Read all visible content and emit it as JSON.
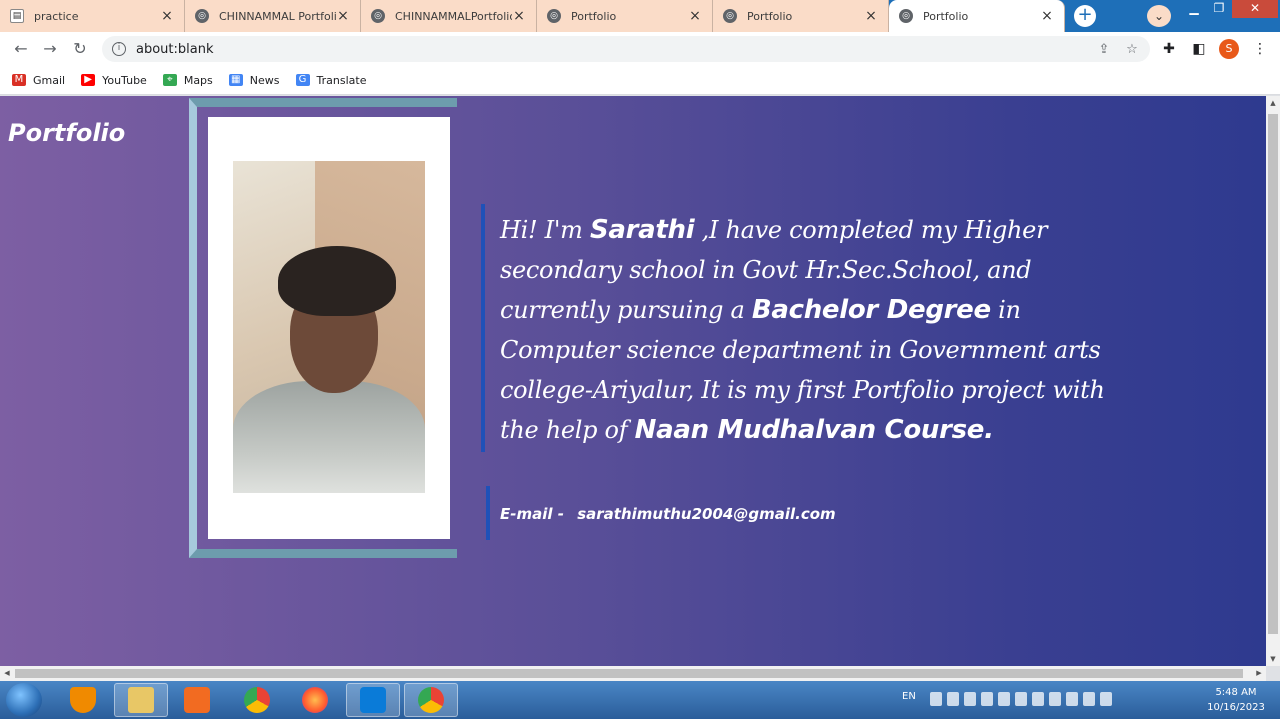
{
  "tabs": [
    {
      "title": "practice",
      "icon": "document-icon",
      "active": false
    },
    {
      "title": "CHINNAMMAL Portfolio",
      "icon": "globe-icon",
      "active": false
    },
    {
      "title": "CHINNAMMALPortfolio",
      "icon": "globe-icon",
      "active": false
    },
    {
      "title": "Portfolio",
      "icon": "globe-icon",
      "active": false
    },
    {
      "title": "Portfolio",
      "icon": "globe-icon",
      "active": false
    },
    {
      "title": "Portfolio",
      "icon": "globe-icon",
      "active": true
    }
  ],
  "address_bar": {
    "url": "about:blank"
  },
  "profile_initial": "S",
  "bookmarks": [
    {
      "label": "Gmail",
      "icon": "gmail-icon",
      "color": "#d93025"
    },
    {
      "label": "YouTube",
      "icon": "youtube-icon",
      "color": "#ff0000"
    },
    {
      "label": "Maps",
      "icon": "maps-icon",
      "color": "#34a853"
    },
    {
      "label": "News",
      "icon": "news-icon",
      "color": "#4285f4"
    },
    {
      "label": "Translate",
      "icon": "translate-icon",
      "color": "#4285f4"
    }
  ],
  "page": {
    "logo": "Portfolio",
    "intro": {
      "t1": "Hi! I'm ",
      "name": "Sarathi",
      "t2": " ,I have completed my Higher secondary school in Govt Hr.Sec.School, and currently pursuing a ",
      "degree": "Bachelor Degree",
      "t3": " in Computer science department in Government arts college-Ariyalur, It is my first Portfolio project with the help of ",
      "course": "Naan Mudhalvan Course."
    },
    "email": {
      "label": "E-mail -",
      "value": "sarathimuthu2004@gmail.com"
    }
  },
  "taskbar": {
    "lang": "EN",
    "time": "5:48 AM",
    "date": "10/16/2023"
  },
  "colors": {
    "tab_inactive": "#fadcc8",
    "titlebar": "#1e6fb8",
    "page_gradient_start": "#7d5fa3",
    "page_gradient_end": "#2e3a8f",
    "accent_bar": "#1f51b8",
    "frame_teal": "#6d9cad"
  }
}
